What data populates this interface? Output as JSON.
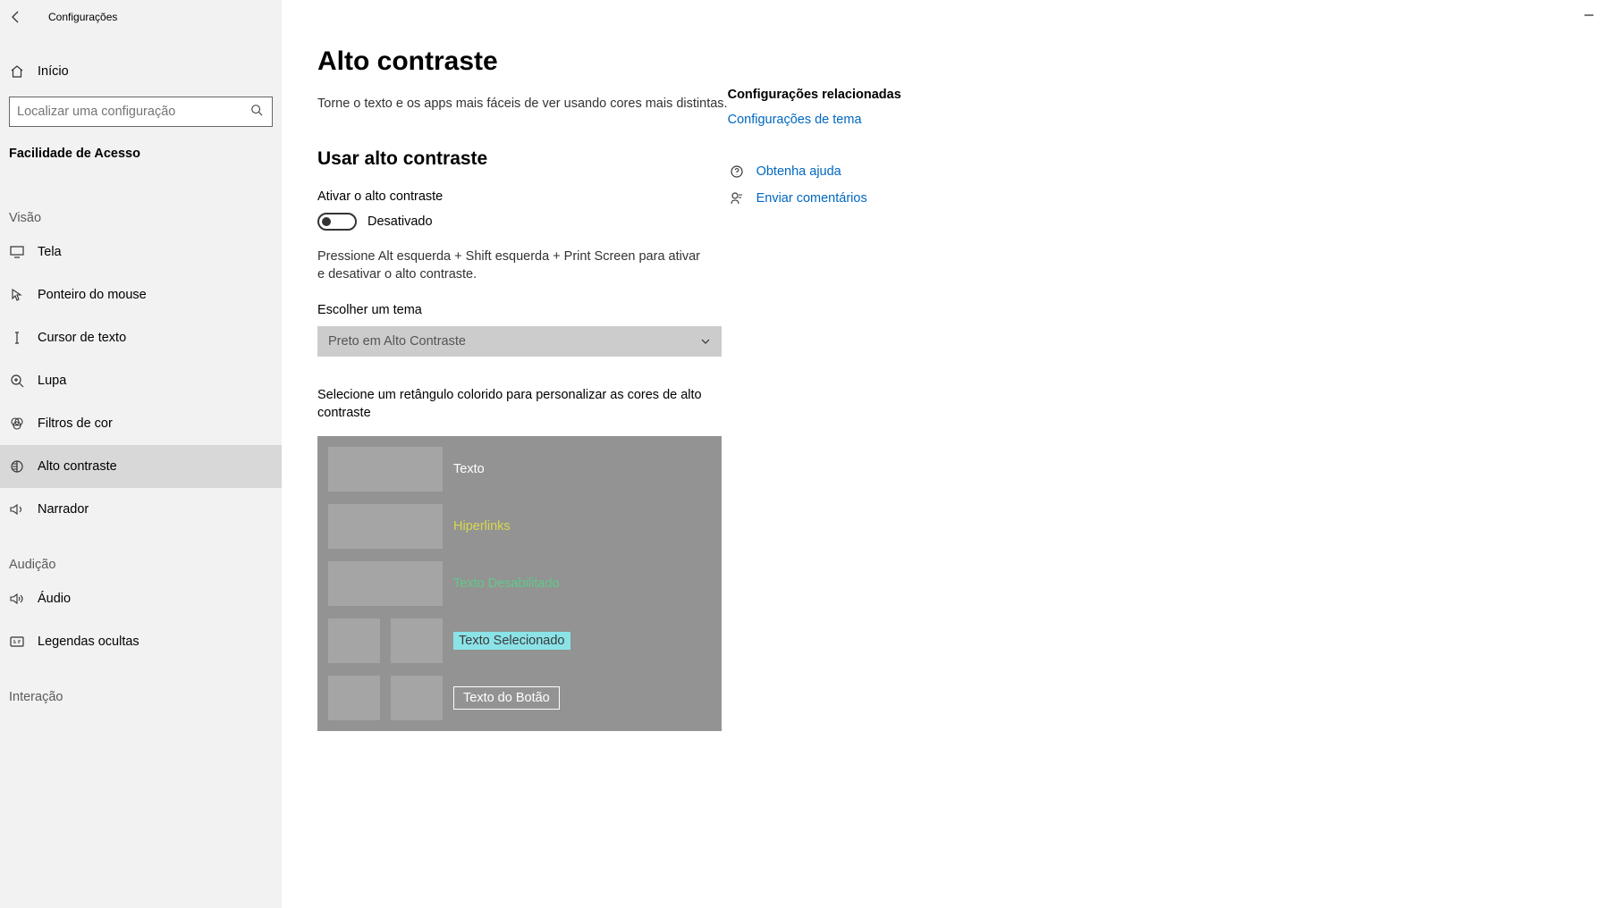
{
  "app_title": "Configurações",
  "home_label": "Início",
  "search_placeholder": "Localizar uma configuração",
  "category": "Facilidade de Acesso",
  "groups": {
    "visao": "Visão",
    "audicao": "Audição",
    "interacao": "Interação"
  },
  "nav": {
    "tela": "Tela",
    "ponteiro": "Ponteiro do mouse",
    "cursor": "Cursor de texto",
    "lupa": "Lupa",
    "filtros": "Filtros de cor",
    "alto_contraste": "Alto contraste",
    "narrador": "Narrador",
    "audio": "Áudio",
    "legendas": "Legendas ocultas"
  },
  "page": {
    "title": "Alto contraste",
    "description": "Torne o texto e os apps mais fáceis de ver usando cores mais distintas.",
    "section_title": "Usar alto contraste",
    "toggle_label": "Ativar o alto contraste",
    "toggle_state": "Desativado",
    "hint": "Pressione Alt esquerda + Shift esquerda + Print Screen para ativar e desativar o alto contraste.",
    "theme_label": "Escolher um tema",
    "theme_value": "Preto em Alto Contraste",
    "customize_label": "Selecione um retângulo colorido para personalizar as cores de alto contraste",
    "preview": {
      "texto": "Texto",
      "hiperlinks": "Hiperlinks",
      "desabilitado": "Texto Desabilitado",
      "selecionado": "Texto Selecionado",
      "botao": "Texto do Botão"
    }
  },
  "right": {
    "related_heading": "Configurações relacionadas",
    "theme_link": "Configurações de tema",
    "help": "Obtenha ajuda",
    "feedback": "Enviar comentários"
  }
}
